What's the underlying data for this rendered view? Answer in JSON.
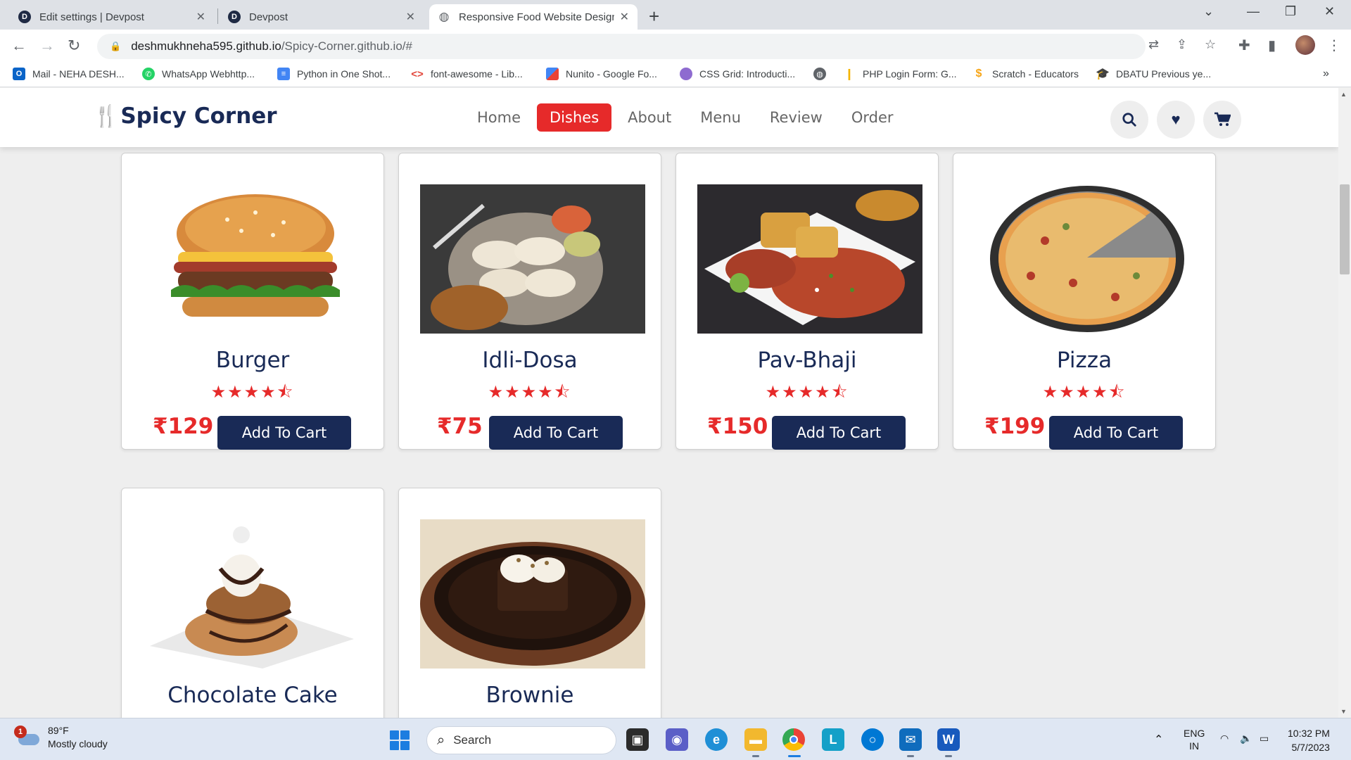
{
  "browser": {
    "tabs": [
      {
        "title": "Edit settings | Devpost",
        "favicon": "D"
      },
      {
        "title": "Devpost",
        "favicon": "D"
      },
      {
        "title": "Responsive Food Website Design",
        "favicon": "globe"
      }
    ],
    "url_host": "deshmukhneha595.github.io",
    "url_path": "/Spicy-Corner.github.io/#",
    "bookmarks": [
      "Mail - NEHA DESH...",
      "WhatsApp Webhttp...",
      "Python in One Shot...",
      "font-awesome - Lib...",
      "Nunito - Google Fo...",
      "CSS Grid: Introducti...",
      "PHP Login Form: G...",
      "Scratch - Educators",
      "DBATU Previous ye..."
    ],
    "bookmarks_more": "»"
  },
  "site": {
    "logo": "Spicy Corner",
    "nav": [
      "Home",
      "Dishes",
      "About",
      "Menu",
      "Review",
      "Order"
    ],
    "active_nav": "Dishes",
    "accent": "#e62a2a",
    "brand": "#192a56"
  },
  "dishes": [
    {
      "name": "Burger",
      "price": "₹129",
      "rating": 4.5,
      "button": "Add To Cart"
    },
    {
      "name": "Idli-Dosa",
      "price": "₹75",
      "rating": 4.5,
      "button": "Add To Cart"
    },
    {
      "name": "Pav-Bhaji",
      "price": "₹150",
      "rating": 4.5,
      "button": "Add To Cart"
    },
    {
      "name": "Pizza",
      "price": "₹199",
      "rating": 4.5,
      "button": "Add To Cart"
    },
    {
      "name": "Chocolate Cake"
    },
    {
      "name": "Brownie"
    }
  ],
  "taskbar": {
    "weather_badge": "1",
    "temperature": "89°F",
    "condition": "Mostly cloudy",
    "search": "Search",
    "language": "ENG",
    "region": "IN",
    "time": "10:32 PM",
    "date": "5/7/2023"
  }
}
